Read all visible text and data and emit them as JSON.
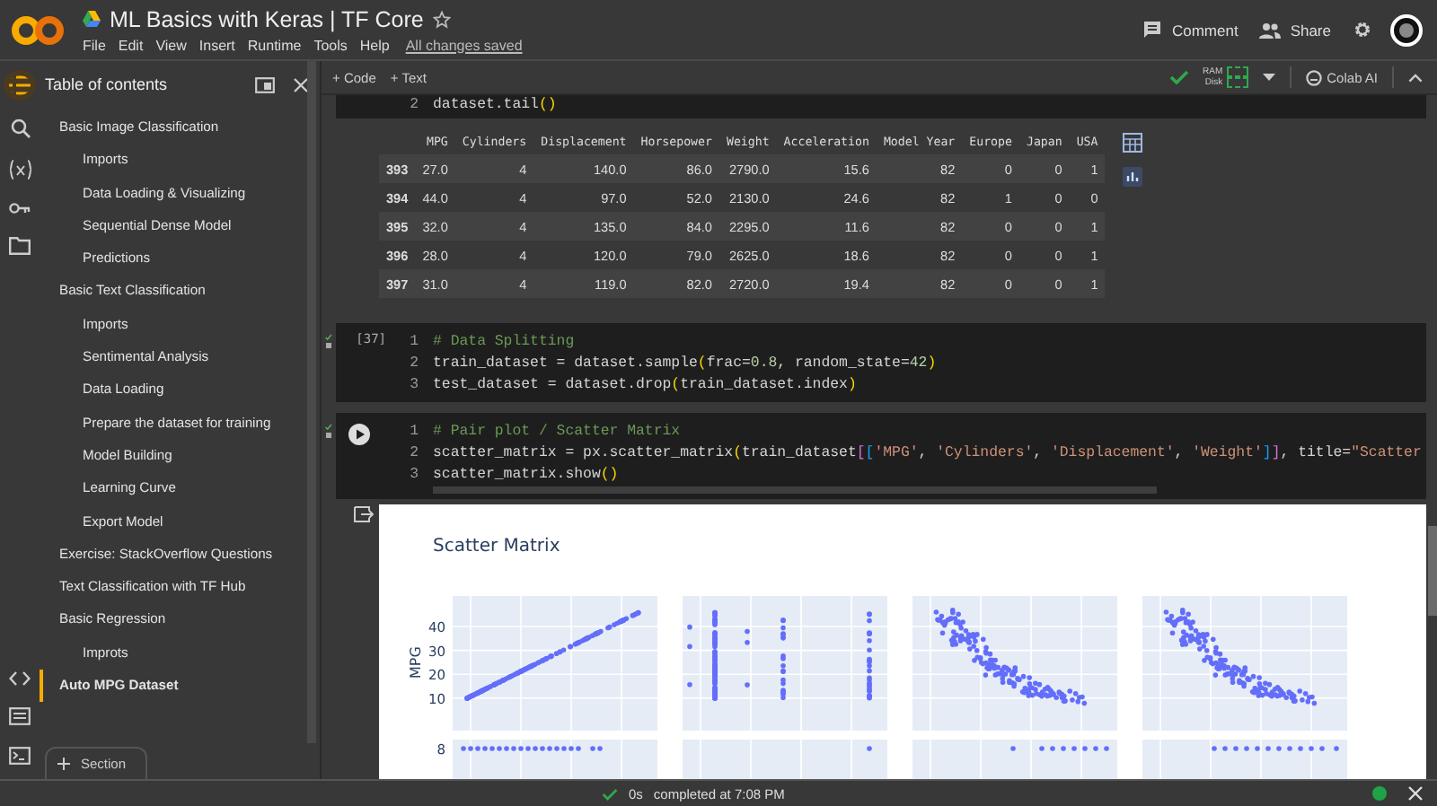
{
  "app": {
    "title": "ML Basics with Keras | TF Core",
    "menu": [
      "File",
      "Edit",
      "View",
      "Insert",
      "Runtime",
      "Tools",
      "Help"
    ],
    "save_status": "All changes saved",
    "actions": [
      {
        "label": "Comment",
        "kind": "comment"
      },
      {
        "label": "Share",
        "kind": "share"
      }
    ]
  },
  "toolbar": {
    "add_buttons": [
      "+ Code",
      "+ Text"
    ],
    "ram_label": "RAM",
    "disk_label": "Disk",
    "ai_button": "Colab AI"
  },
  "sidebar": {
    "title": "Table of contents",
    "add_section": "Section",
    "items": [
      {
        "label": "Basic Image Classification",
        "selected": false,
        "children": [
          {
            "label": "Imports",
            "selected": false
          },
          {
            "label": "Data Loading & Visualizing",
            "selected": false
          },
          {
            "label": "Sequential Dense Model",
            "selected": false
          },
          {
            "label": "Predictions",
            "selected": false
          }
        ]
      },
      {
        "label": "Basic Text Classification",
        "selected": false,
        "children": [
          {
            "label": "Imports",
            "selected": false
          },
          {
            "label": "Sentimental Analysis",
            "selected": false
          },
          {
            "label": "Data Loading",
            "selected": false
          },
          {
            "label": "Prepare the dataset for training",
            "selected": false
          },
          {
            "label": "Model Building",
            "selected": false
          },
          {
            "label": "Learning Curve",
            "selected": false
          },
          {
            "label": "Export Model",
            "selected": false
          }
        ]
      },
      {
        "label": "Exercise: StackOverflow Questions",
        "selected": false
      },
      {
        "label": "Text Classification with TF Hub",
        "selected": false
      },
      {
        "label": "Basic Regression",
        "selected": false,
        "children": [
          {
            "label": "Improts",
            "selected": false
          }
        ]
      },
      {
        "label": "Auto MPG Dataset",
        "selected": true
      }
    ]
  },
  "cells": [
    {
      "run_button": false,
      "lines": [
        {
          "n": "2",
          "tokens": [
            {
              "t": "dataset.tail",
              "kind": "plain"
            },
            {
              "t": "()",
              "kind": "paren"
            }
          ]
        }
      ],
      "output": {
        "kind": "table",
        "columns": [
          "MPG",
          "Cylinders",
          "Displacement",
          "Horsepower",
          "Weight",
          "Acceleration",
          "Model Year",
          "Europe",
          "Japan",
          "USA"
        ],
        "rows": [
          {
            "index": "393",
            "values": [
              "27.0",
              "4",
              "140.0",
              "86.0",
              "2790.0",
              "15.6",
              "82",
              "0",
              "0",
              "1"
            ]
          },
          {
            "index": "394",
            "values": [
              "44.0",
              "4",
              "97.0",
              "52.0",
              "2130.0",
              "24.6",
              "82",
              "1",
              "0",
              "0"
            ]
          },
          {
            "index": "395",
            "values": [
              "32.0",
              "4",
              "135.0",
              "84.0",
              "2295.0",
              "11.6",
              "82",
              "0",
              "0",
              "1"
            ]
          },
          {
            "index": "396",
            "values": [
              "28.0",
              "4",
              "120.0",
              "79.0",
              "2625.0",
              "18.6",
              "82",
              "0",
              "0",
              "1"
            ]
          },
          {
            "index": "397",
            "values": [
              "31.0",
              "4",
              "119.0",
              "82.0",
              "2720.0",
              "19.4",
              "82",
              "0",
              "0",
              "1"
            ]
          }
        ]
      }
    },
    {
      "exec_count": "[37]",
      "run_button": false,
      "lines": [
        {
          "n": "1",
          "tokens": [
            {
              "t": "# Data Splitting",
              "kind": "comment"
            }
          ]
        },
        {
          "n": "2",
          "tokens": [
            {
              "t": "train_dataset = dataset.sample",
              "kind": "plain"
            },
            {
              "t": "(",
              "kind": "paren"
            },
            {
              "t": "frac=",
              "kind": "plain"
            },
            {
              "t": "0.8",
              "kind": "number"
            },
            {
              "t": ", random_state=",
              "kind": "plain"
            },
            {
              "t": "42",
              "kind": "number"
            },
            {
              "t": ")",
              "kind": "paren"
            }
          ]
        },
        {
          "n": "3",
          "tokens": [
            {
              "t": "test_dataset = dataset.drop",
              "kind": "plain"
            },
            {
              "t": "(",
              "kind": "paren"
            },
            {
              "t": "train_dataset.index",
              "kind": "plain"
            },
            {
              "t": ")",
              "kind": "paren"
            }
          ]
        }
      ]
    },
    {
      "run_button": true,
      "lines": [
        {
          "n": "1",
          "tokens": [
            {
              "t": "# Pair plot / Scatter Matrix",
              "kind": "comment"
            }
          ]
        },
        {
          "n": "2",
          "tokens": [
            {
              "t": "scatter_matrix = px.scatter_matrix",
              "kind": "plain"
            },
            {
              "t": "(",
              "kind": "paren"
            },
            {
              "t": "train_dataset",
              "kind": "plain"
            },
            {
              "t": "[",
              "kind": "bracket"
            },
            {
              "t": "[",
              "kind": "bracket2"
            },
            {
              "t": "'MPG'",
              "kind": "string"
            },
            {
              "t": ", ",
              "kind": "plain"
            },
            {
              "t": "'Cylinders'",
              "kind": "string"
            },
            {
              "t": ", ",
              "kind": "plain"
            },
            {
              "t": "'Displacement'",
              "kind": "string"
            },
            {
              "t": ", ",
              "kind": "plain"
            },
            {
              "t": "'Weight'",
              "kind": "string"
            },
            {
              "t": "]",
              "kind": "bracket2"
            },
            {
              "t": "]",
              "kind": "bracket"
            },
            {
              "t": ", title=",
              "kind": "plain"
            },
            {
              "t": "\"Scatter",
              "kind": "string"
            }
          ]
        },
        {
          "n": "3",
          "tokens": [
            {
              "t": "scatter_matrix.show",
              "kind": "plain"
            },
            {
              "t": "()",
              "kind": "paren"
            }
          ]
        }
      ],
      "output": {
        "kind": "chart",
        "title": "Scatter Matrix",
        "y_label": "MPG",
        "y_ticks": [
          "40",
          "30",
          "20",
          "10"
        ],
        "second_row_tick": "8"
      }
    }
  ],
  "status_bar": {
    "duration": "0s",
    "message": "completed at 7:08 PM"
  }
}
